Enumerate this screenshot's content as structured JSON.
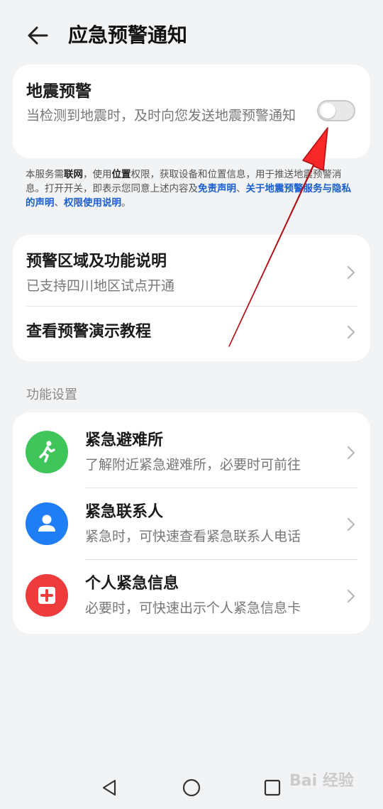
{
  "header": {
    "title": "应急预警通知"
  },
  "earthquake": {
    "title": "地震预警",
    "description": "当检测到地震时，及时向您发送地震预警通知",
    "toggle_on": false
  },
  "notice": {
    "t1": "本服务需",
    "b1": "联网",
    "t2": "，使用",
    "b2": "位置",
    "t3": "权限，获取设备和位置信息，用于推送地震预警消息。打开开关，即表示您同意上述内容及",
    "link1": "免责声明",
    "sep1": "、",
    "link2": "关于地震预警服务与隐私的声明",
    "sep2": "、",
    "link3": "权限使用说明",
    "end": "。"
  },
  "info": {
    "region_title": "预警区域及功能说明",
    "region_sub": "已支持四川地区试点开通",
    "tutorial_title": "查看预警演示教程"
  },
  "section_label": "功能设置",
  "functions": [
    {
      "title": "紧急避难所",
      "subtitle": "了解附近紧急避难所，必要时可前往",
      "icon": "running-person-icon",
      "color": "#3fc55a"
    },
    {
      "title": "紧急联系人",
      "subtitle": "紧急时，可快速查看紧急联系人电话",
      "icon": "person-icon",
      "color": "#1f7ef5"
    },
    {
      "title": "个人紧急信息",
      "subtitle": "必要时，可快速出示个人紧急信息卡",
      "icon": "medical-cross-icon",
      "color": "#ee3b3b"
    }
  ],
  "watermark": "Bai 经验"
}
